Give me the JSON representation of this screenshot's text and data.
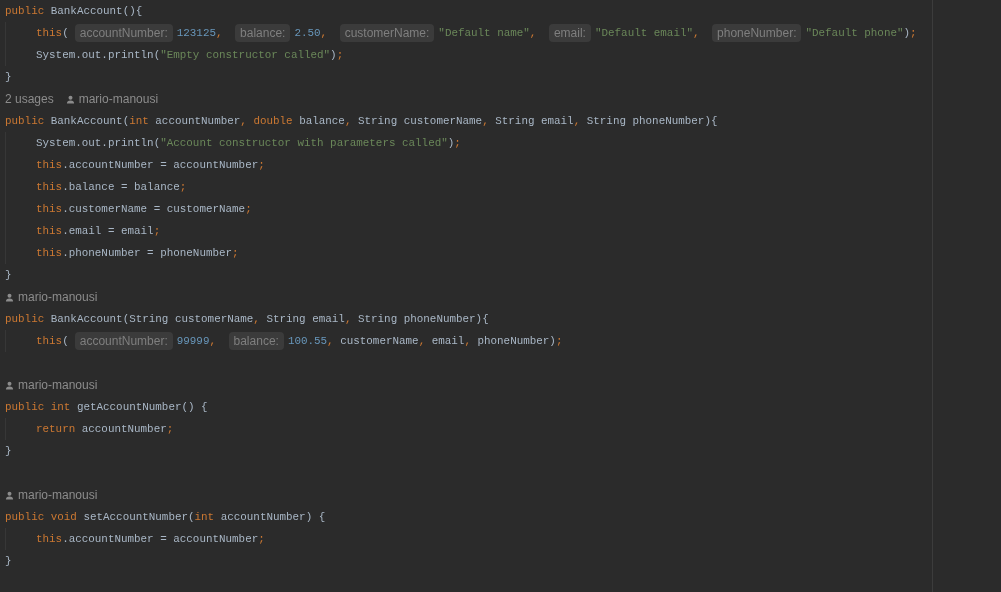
{
  "editor": {
    "lines": [
      {
        "kind": "code",
        "indented": false,
        "tokens": [
          {
            "kind": "keyword",
            "text": "public"
          },
          {
            "kind": "plain",
            "text": " BankAccount(){"
          }
        ]
      },
      {
        "kind": "code",
        "indented": true,
        "tokens": [
          {
            "kind": "keyword",
            "text": "this"
          },
          {
            "kind": "plain",
            "text": "("
          },
          {
            "kind": "hint",
            "text": "accountNumber:"
          },
          {
            "kind": "number",
            "text": "123125"
          },
          {
            "kind": "punct",
            "text": ", "
          },
          {
            "kind": "hint",
            "text": "balance:"
          },
          {
            "kind": "number",
            "text": "2.50"
          },
          {
            "kind": "punct",
            "text": ", "
          },
          {
            "kind": "hint",
            "text": "customerName:"
          },
          {
            "kind": "string",
            "text": "\"Default name\""
          },
          {
            "kind": "punct",
            "text": ", "
          },
          {
            "kind": "hint",
            "text": "email:"
          },
          {
            "kind": "string",
            "text": "\"Default email\""
          },
          {
            "kind": "punct",
            "text": ", "
          },
          {
            "kind": "hint",
            "text": "phoneNumber:"
          },
          {
            "kind": "string",
            "text": "\"Default phone\""
          },
          {
            "kind": "plain",
            "text": ")"
          },
          {
            "kind": "punct",
            "text": ";"
          }
        ]
      },
      {
        "kind": "code",
        "indented": true,
        "tokens": [
          {
            "kind": "plain",
            "text": "System.out.println("
          },
          {
            "kind": "string",
            "text": "\"Empty constructor called\""
          },
          {
            "kind": "plain",
            "text": ")"
          },
          {
            "kind": "punct",
            "text": ";"
          }
        ]
      },
      {
        "kind": "code",
        "indented": false,
        "tokens": [
          {
            "kind": "plain",
            "text": "}"
          }
        ]
      },
      {
        "kind": "meta",
        "usages": "2 usages",
        "author": "mario-manousi"
      },
      {
        "kind": "code",
        "indented": false,
        "tokens": [
          {
            "kind": "keyword",
            "text": "public"
          },
          {
            "kind": "plain",
            "text": " BankAccount("
          },
          {
            "kind": "keyword",
            "text": "int"
          },
          {
            "kind": "plain",
            "text": " accountNumber"
          },
          {
            "kind": "punct",
            "text": ", "
          },
          {
            "kind": "keyword",
            "text": "double"
          },
          {
            "kind": "plain",
            "text": " balance"
          },
          {
            "kind": "punct",
            "text": ", "
          },
          {
            "kind": "plain",
            "text": "String customerName"
          },
          {
            "kind": "punct",
            "text": ", "
          },
          {
            "kind": "plain",
            "text": "String email"
          },
          {
            "kind": "punct",
            "text": ", "
          },
          {
            "kind": "plain",
            "text": "String phoneNumber){"
          }
        ]
      },
      {
        "kind": "code",
        "indented": true,
        "tokens": [
          {
            "kind": "plain",
            "text": "System.out.println("
          },
          {
            "kind": "string",
            "text": "\"Account constructor with parameters called\""
          },
          {
            "kind": "plain",
            "text": ")"
          },
          {
            "kind": "punct",
            "text": ";"
          }
        ]
      },
      {
        "kind": "code",
        "indented": true,
        "tokens": [
          {
            "kind": "keyword",
            "text": "this"
          },
          {
            "kind": "plain",
            "text": ".accountNumber = accountNumber"
          },
          {
            "kind": "punct",
            "text": ";"
          }
        ]
      },
      {
        "kind": "code",
        "indented": true,
        "tokens": [
          {
            "kind": "keyword",
            "text": "this"
          },
          {
            "kind": "plain",
            "text": ".balance = balance"
          },
          {
            "kind": "punct",
            "text": ";"
          }
        ]
      },
      {
        "kind": "code",
        "indented": true,
        "tokens": [
          {
            "kind": "keyword",
            "text": "this"
          },
          {
            "kind": "plain",
            "text": ".customerName = customerName"
          },
          {
            "kind": "punct",
            "text": ";"
          }
        ]
      },
      {
        "kind": "code",
        "indented": true,
        "tokens": [
          {
            "kind": "keyword",
            "text": "this"
          },
          {
            "kind": "plain",
            "text": ".email = email"
          },
          {
            "kind": "punct",
            "text": ";"
          }
        ]
      },
      {
        "kind": "code",
        "indented": true,
        "tokens": [
          {
            "kind": "keyword",
            "text": "this"
          },
          {
            "kind": "plain",
            "text": ".phoneNumber = phoneNumber"
          },
          {
            "kind": "punct",
            "text": ";"
          }
        ]
      },
      {
        "kind": "code",
        "indented": false,
        "tokens": [
          {
            "kind": "plain",
            "text": "}"
          }
        ]
      },
      {
        "kind": "meta",
        "author": "mario-manousi"
      },
      {
        "kind": "code",
        "indented": false,
        "tokens": [
          {
            "kind": "keyword",
            "text": "public"
          },
          {
            "kind": "plain",
            "text": " BankAccount(String customerName"
          },
          {
            "kind": "punct",
            "text": ", "
          },
          {
            "kind": "plain",
            "text": "String email"
          },
          {
            "kind": "punct",
            "text": ", "
          },
          {
            "kind": "plain",
            "text": "String phoneNumber){"
          }
        ]
      },
      {
        "kind": "code",
        "indented": true,
        "tokens": [
          {
            "kind": "keyword",
            "text": "this"
          },
          {
            "kind": "plain",
            "text": "("
          },
          {
            "kind": "hint",
            "text": "accountNumber:"
          },
          {
            "kind": "number",
            "text": "99999"
          },
          {
            "kind": "punct",
            "text": ", "
          },
          {
            "kind": "hint",
            "text": "balance:"
          },
          {
            "kind": "number",
            "text": "100.55"
          },
          {
            "kind": "punct",
            "text": ", "
          },
          {
            "kind": "param",
            "text": "customerName"
          },
          {
            "kind": "punct",
            "text": ", "
          },
          {
            "kind": "param",
            "text": "email"
          },
          {
            "kind": "punct",
            "text": ", "
          },
          {
            "kind": "param",
            "text": "phoneNumber"
          },
          {
            "kind": "plain",
            "text": ")"
          },
          {
            "kind": "punct",
            "text": ";"
          }
        ]
      },
      {
        "kind": "blank"
      },
      {
        "kind": "meta",
        "author": "mario-manousi"
      },
      {
        "kind": "code",
        "indented": false,
        "tokens": [
          {
            "kind": "keyword",
            "text": "public int"
          },
          {
            "kind": "plain",
            "text": " getAccountNumber() {"
          }
        ]
      },
      {
        "kind": "code",
        "indented": true,
        "tokens": [
          {
            "kind": "keyword",
            "text": "return"
          },
          {
            "kind": "plain",
            "text": " accountNumber"
          },
          {
            "kind": "punct",
            "text": ";"
          }
        ]
      },
      {
        "kind": "code",
        "indented": false,
        "tokens": [
          {
            "kind": "plain",
            "text": "}"
          }
        ]
      },
      {
        "kind": "blank"
      },
      {
        "kind": "meta",
        "author": "mario-manousi"
      },
      {
        "kind": "code",
        "indented": false,
        "tokens": [
          {
            "kind": "keyword",
            "text": "public void"
          },
          {
            "kind": "plain",
            "text": " setAccountNumber("
          },
          {
            "kind": "keyword",
            "text": "int"
          },
          {
            "kind": "plain",
            "text": " accountNumber) {"
          }
        ]
      },
      {
        "kind": "code",
        "indented": true,
        "tokens": [
          {
            "kind": "keyword",
            "text": "this"
          },
          {
            "kind": "plain",
            "text": ".accountNumber = accountNumber"
          },
          {
            "kind": "punct",
            "text": ";"
          }
        ]
      },
      {
        "kind": "code",
        "indented": false,
        "tokens": [
          {
            "kind": "plain",
            "text": "}"
          }
        ]
      }
    ]
  }
}
